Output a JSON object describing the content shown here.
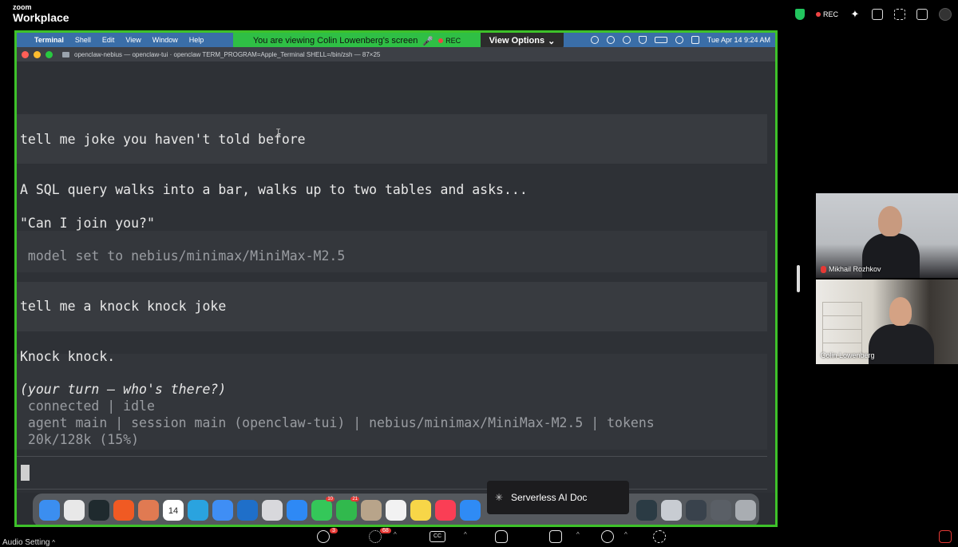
{
  "zoom": {
    "brand_small": "zoom",
    "brand_big": "Workplace",
    "rec_label": "REC"
  },
  "mac_menu": {
    "apple": "",
    "app_name": "Terminal",
    "items": [
      "Shell",
      "Edit",
      "View",
      "Window",
      "Help"
    ],
    "datetime": "Tue Apr 14  9:24 AM"
  },
  "share_banner": {
    "text": "You are viewing  Colin Lowenberg's screen",
    "rec": "REC",
    "view_options": "View Options"
  },
  "terminal": {
    "title": "openclaw-nebius — openclaw-tui · openclaw TERM_PROGRAM=Apple_Terminal SHELL=/bin/zsh — 87×25",
    "lines": {
      "user1": "tell me joke you haven't told before",
      "reply1a": "A SQL query walks into a bar, walks up to two tables and asks...",
      "reply1b": "\"Can I join you?\"",
      "sys1": " model set to nebius/minimax/MiniMax-M2.5",
      "user2": "tell me a knock knock joke",
      "reply2a": "Knock knock.",
      "reply2b": "(your turn — who's there?)",
      "status1": " connected | idle",
      "status2": " agent main | session main (openclaw-tui) | nebius/minimax/MiniMax-M2.5 | tokens",
      "status3": " 20k/128k (15%)"
    }
  },
  "dock": {
    "tooltip": "Serverless AI Doc",
    "calendar_day": "14",
    "apps": [
      {
        "name": "finder",
        "color": "#3b8ef0"
      },
      {
        "name": "slack",
        "color": "#e8e8e8"
      },
      {
        "name": "perplexity",
        "color": "#1f2a2e"
      },
      {
        "name": "brave",
        "color": "#f05a23"
      },
      {
        "name": "claude",
        "color": "#e07a52"
      },
      {
        "name": "calendar",
        "color": "#ffffff"
      },
      {
        "name": "telegram",
        "color": "#2aa3df"
      },
      {
        "name": "mail",
        "color": "#3f8ef5"
      },
      {
        "name": "outlook",
        "color": "#1f6fc9"
      },
      {
        "name": "launchpad",
        "color": "#d8d8dc"
      },
      {
        "name": "safari",
        "color": "#2e89f5"
      },
      {
        "name": "messages",
        "color": "#34c759",
        "badge": "10"
      },
      {
        "name": "facetime",
        "color": "#31b94d",
        "badge": "21"
      },
      {
        "name": "contacts",
        "color": "#b8a48a"
      },
      {
        "name": "reminders",
        "color": "#f2f2f2"
      },
      {
        "name": "notes",
        "color": "#f7d648"
      },
      {
        "name": "music",
        "color": "#fa3e55"
      },
      {
        "name": "app-store",
        "color": "#2f8bf5"
      },
      {
        "name": "terminal-thumb",
        "color": "#2b3b44"
      },
      {
        "name": "window-thumb",
        "color": "#c8ccd2"
      },
      {
        "name": "window-thumb-2",
        "color": "#39424c"
      },
      {
        "name": "window-thumb-3",
        "color": "#5a5f66"
      },
      {
        "name": "trash",
        "color": "#a9adb2"
      }
    ]
  },
  "participants": [
    {
      "name": "Mikhail Rozhkov",
      "muted": true
    },
    {
      "name": "Colin Lowenberg",
      "muted": false
    }
  ],
  "toolbar": {
    "audio_setting": "Audio Setting",
    "chat_badge": "3",
    "participants_badge": "68"
  }
}
